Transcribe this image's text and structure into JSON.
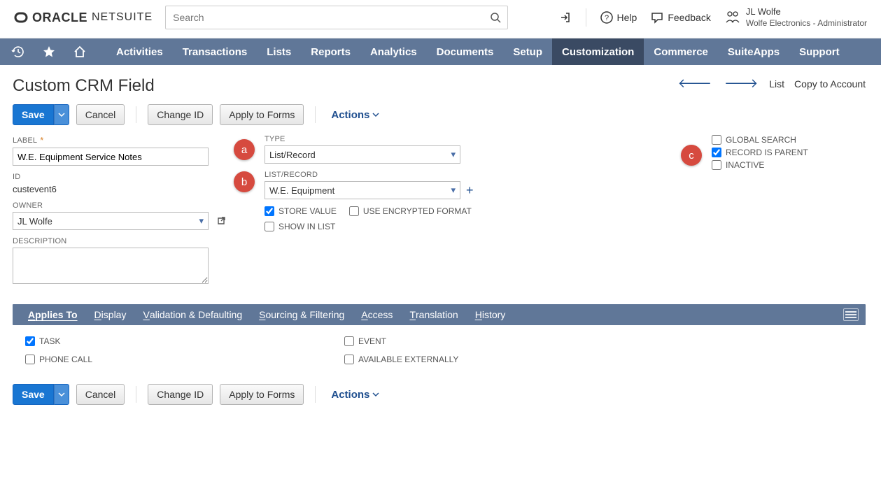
{
  "header": {
    "search_placeholder": "Search",
    "help": "Help",
    "feedback": "Feedback",
    "user_name": "JL Wolfe",
    "user_role": "Wolfe Electronics - Administrator"
  },
  "nav": {
    "items": [
      "Activities",
      "Transactions",
      "Lists",
      "Reports",
      "Analytics",
      "Documents",
      "Setup",
      "Customization",
      "Commerce",
      "SuiteApps",
      "Support"
    ],
    "active_index": 7
  },
  "page": {
    "title": "Custom CRM Field",
    "top_links": {
      "list": "List",
      "copy": "Copy to Account"
    },
    "buttons": {
      "save": "Save",
      "cancel": "Cancel",
      "change_id": "Change ID",
      "apply_forms": "Apply to Forms",
      "actions": "Actions"
    }
  },
  "form": {
    "label": {
      "label": "LABEL",
      "value": "W.E. Equipment Service Notes"
    },
    "id": {
      "label": "ID",
      "value": "custevent6"
    },
    "owner": {
      "label": "OWNER",
      "value": "JL Wolfe"
    },
    "description": {
      "label": "DESCRIPTION",
      "value": ""
    },
    "type": {
      "label": "TYPE",
      "value": "List/Record"
    },
    "list_record": {
      "label": "LIST/RECORD",
      "value": "W.E. Equipment"
    },
    "store_value": {
      "label": "STORE VALUE",
      "checked": true
    },
    "encrypted": {
      "label": "USE ENCRYPTED FORMAT",
      "checked": false
    },
    "show_in_list": {
      "label": "SHOW IN LIST",
      "checked": false
    },
    "global_search": {
      "label": "GLOBAL SEARCH",
      "checked": false
    },
    "record_parent": {
      "label": "RECORD IS PARENT",
      "checked": true
    },
    "inactive": {
      "label": "INACTIVE",
      "checked": false
    }
  },
  "tabs": {
    "items": [
      {
        "letter": "A",
        "rest": "pplies To"
      },
      {
        "letter": "D",
        "rest": "isplay"
      },
      {
        "letter": "V",
        "rest": "alidation & Defaulting"
      },
      {
        "letter": "S",
        "rest": "ourcing & Filtering"
      },
      {
        "letter": "A",
        "rest": "ccess"
      },
      {
        "letter": "T",
        "rest": "ranslation"
      },
      {
        "letter": "H",
        "rest": "istory"
      }
    ],
    "active_index": 0
  },
  "applies_to": {
    "task": {
      "label": "TASK",
      "checked": true
    },
    "phone_call": {
      "label": "PHONE CALL",
      "checked": false
    },
    "event": {
      "label": "EVENT",
      "checked": false
    },
    "available_ext": {
      "label": "AVAILABLE EXTERNALLY",
      "checked": false
    }
  },
  "annotations": {
    "a": "a",
    "b": "b",
    "c": "c"
  }
}
